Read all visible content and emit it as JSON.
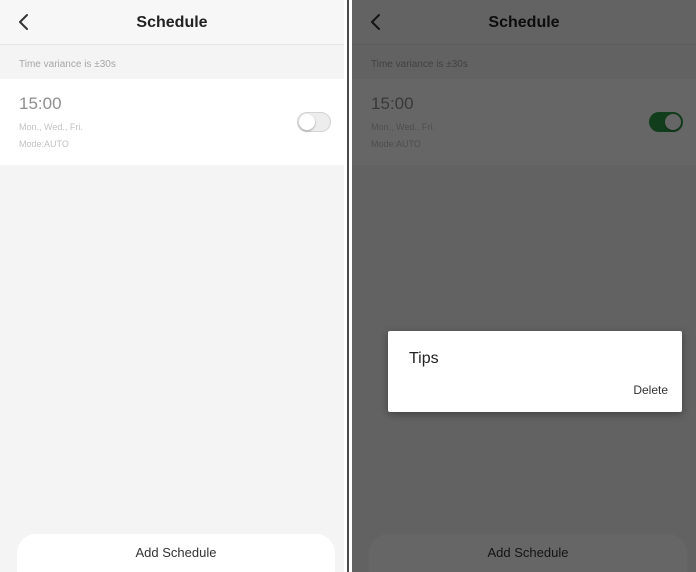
{
  "header": {
    "title": "Schedule"
  },
  "schedule": {
    "variance_note": "Time variance is ±30s",
    "entry": {
      "time": "15:00",
      "days": "Mon., Wed., Fri.",
      "mode": "Mode:AUTO"
    },
    "add_label": "Add Schedule"
  },
  "left_screen": {
    "toggle_on": false
  },
  "right_screen": {
    "toggle_on": true
  },
  "dialog": {
    "title": "Tips",
    "action_label": "Delete"
  },
  "colors": {
    "toggle_on": "#2f9a49",
    "overlay": "#000000"
  },
  "icons": {
    "back": "chevron-left-icon"
  }
}
